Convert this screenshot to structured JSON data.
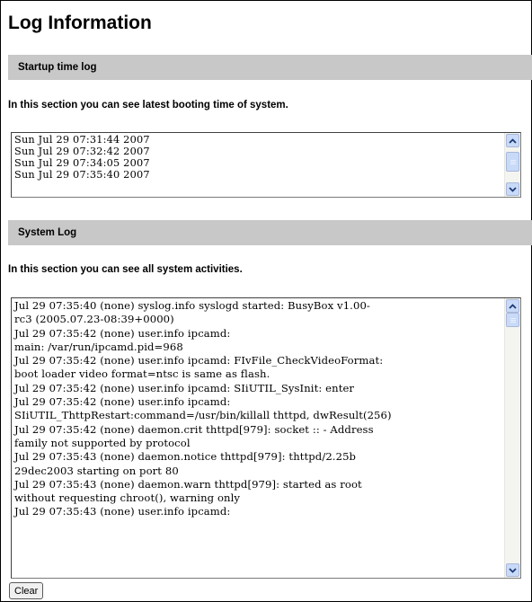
{
  "page": {
    "title": "Log Information"
  },
  "startup": {
    "heading": "Startup time log",
    "description": "In this section you can see latest booting time of system.",
    "log": "Sun Jul 29 07:31:44 2007\nSun Jul 29 07:32:42 2007\nSun Jul 29 07:34:05 2007\nSun Jul 29 07:35:40 2007",
    "scroll_position": 0.85
  },
  "system": {
    "heading": "System Log",
    "description": "In this section you can see all system activities.",
    "log": "Jul 29 07:35:40 (none) syslog.info syslogd started: BusyBox v1.00-\nrc3 (2005.07.23-08:39+0000)\nJul 29 07:35:42 (none) user.info ipcamd:\nmain: /var/run/ipcamd.pid=968\nJul 29 07:35:42 (none) user.info ipcamd: FIvFile_CheckVideoFormat:\nboot loader video format=ntsc is same as flash.\nJul 29 07:35:42 (none) user.info ipcamd: SIiUTIL_SysInit: enter\nJul 29 07:35:42 (none) user.info ipcamd:\nSIiUTIL_ThttpRestart:command=/usr/bin/killall thttpd, dwResult(256)\nJul 29 07:35:42 (none) daemon.crit thttpd[979]: socket :: - Address\nfamily not supported by protocol\nJul 29 07:35:43 (none) daemon.notice thttpd[979]: thttpd/2.25b\n29dec2003 starting on port 80\nJul 29 07:35:43 (none) daemon.warn thttpd[979]: started as root\nwithout requesting chroot(), warning only\nJul 29 07:35:43 (none) user.info ipcamd:",
    "scroll_position": 0.0
  },
  "actions": {
    "clear_label": "Clear"
  },
  "colors": {
    "section_bar": "#c8c8c8",
    "scrollbar_button": "#c9daf8",
    "scrollbar_border": "#a9b8d8"
  },
  "icons": {
    "scroll_up": "chevron-up-icon",
    "scroll_down": "chevron-down-icon"
  }
}
